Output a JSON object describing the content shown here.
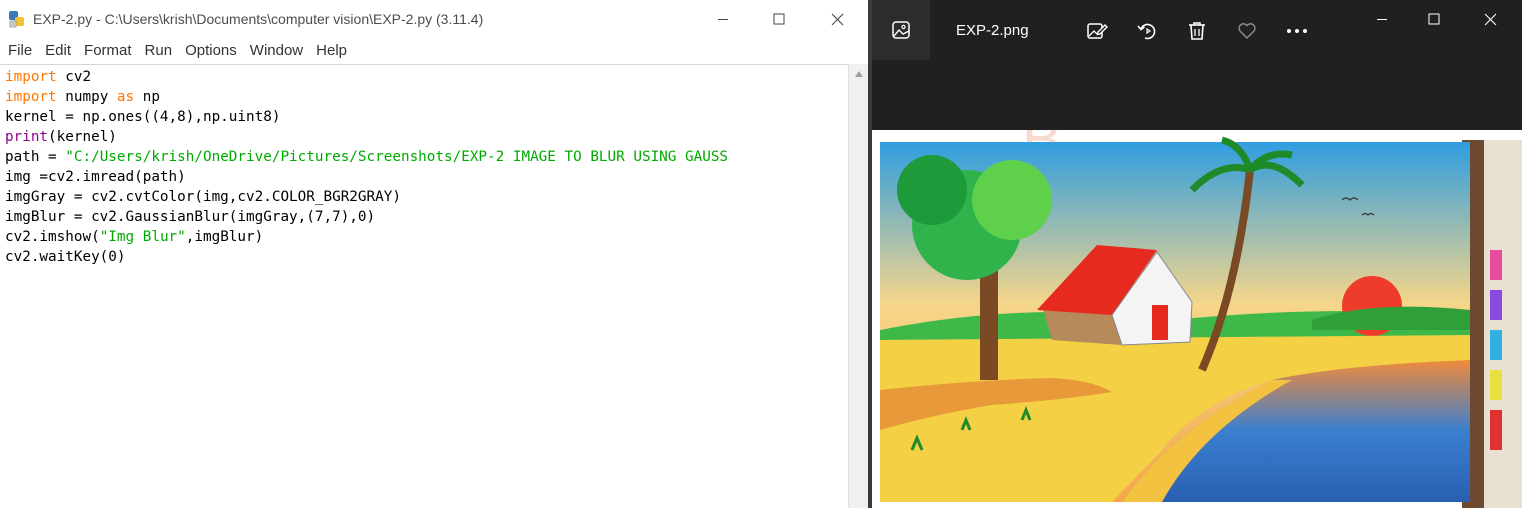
{
  "idle": {
    "title": "EXP-2.py - C:\\Users\\krish\\Documents\\computer vision\\EXP-2.py (3.11.4)",
    "menu": [
      "File",
      "Edit",
      "Format",
      "Run",
      "Options",
      "Window",
      "Help"
    ],
    "code": [
      [
        {
          "t": "import",
          "c": "kw"
        },
        {
          "t": " cv2",
          "c": ""
        }
      ],
      [
        {
          "t": "import",
          "c": "kw"
        },
        {
          "t": " numpy ",
          "c": ""
        },
        {
          "t": "as",
          "c": "kw"
        },
        {
          "t": " np",
          "c": ""
        }
      ],
      [
        {
          "t": "kernel = np.ones((4,8),np.uint8)",
          "c": ""
        }
      ],
      [
        {
          "t": "print",
          "c": "bi"
        },
        {
          "t": "(kernel)",
          "c": ""
        }
      ],
      [
        {
          "t": "path = ",
          "c": ""
        },
        {
          "t": "\"C:/Users/krish/OneDrive/Pictures/Screenshots/EXP-2 IMAGE TO BLUR USING GAUSS",
          "c": "str"
        }
      ],
      [
        {
          "t": "img =cv2.imread(path)",
          "c": ""
        }
      ],
      [
        {
          "t": "imgGray = cv2.cvtColor(img,cv2.COLOR_BGR2GRAY)",
          "c": ""
        }
      ],
      [
        {
          "t": "imgBlur = cv2.GaussianBlur(imgGray,(7,7),0)",
          "c": ""
        }
      ],
      [
        {
          "t": "cv2.imshow(",
          "c": ""
        },
        {
          "t": "\"Img Blur\"",
          "c": "str"
        },
        {
          "t": ",imgBlur)",
          "c": ""
        }
      ],
      [
        {
          "t": "cv2.waitKey(0)",
          "c": ""
        }
      ]
    ]
  },
  "photos": {
    "file_name": "EXP-2.png",
    "icons": {
      "gallery": "image-icon",
      "edit": "edit-image-icon",
      "rotate": "rotate-icon",
      "delete": "trash-icon",
      "favorite": "heart-icon",
      "more": "more-icon"
    }
  },
  "colors": {
    "keyword": "#ff7700",
    "builtin": "#900090",
    "string": "#00aa00",
    "photos_bg": "#202020"
  }
}
